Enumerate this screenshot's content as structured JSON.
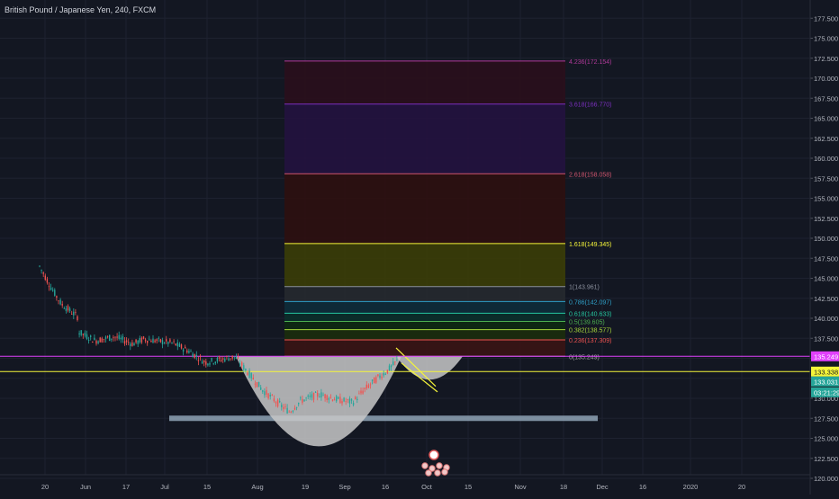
{
  "header": {
    "title": "British Pound / Japanese Yen, 240, FXCM"
  },
  "colors": {
    "background": "#131722",
    "axis_text": "#b2b5be",
    "grid": "#1e2230",
    "up_candle": "#26a69a",
    "down_candle": "#ef5350",
    "magenta": "#e040fb",
    "yellow": "#f5f53a",
    "teal": "#26a69a",
    "cup_fill": "#c8c8c8"
  },
  "chart_data": {
    "type": "candlestick",
    "title": "British Pound / Japanese Yen, 240, FXCM",
    "ylim": [
      118.8,
      178.2
    ],
    "y_ticks": [
      "120.000",
      "122.500",
      "125.000",
      "127.500",
      "130.000",
      "132.500",
      "135.000",
      "137.500",
      "140.000",
      "142.500",
      "145.000",
      "147.500",
      "150.000",
      "152.500",
      "155.000",
      "157.500",
      "160.000",
      "162.500",
      "165.000",
      "167.500",
      "170.000",
      "172.500",
      "175.000",
      "177.500"
    ],
    "x_ticks": [
      "20",
      "Jun",
      "17",
      "Jul",
      "15",
      "Aug",
      "19",
      "Sep",
      "16",
      "Oct",
      "15",
      "Nov",
      "18",
      "Dec",
      "16",
      "2020",
      "20"
    ],
    "price_path": [
      {
        "x": "May 14",
        "close": 146.5
      },
      {
        "x": "May 18",
        "close": 144.0
      },
      {
        "x": "May 22",
        "close": 141.8
      },
      {
        "x": "May 28",
        "close": 140.2
      },
      {
        "x": "Jun 3",
        "close": 138.4
      },
      {
        "x": "Jun 10",
        "close": 137.2
      },
      {
        "x": "Jun 17",
        "close": 137.7
      },
      {
        "x": "Jun 24",
        "close": 136.8
      },
      {
        "x": "Jun 28",
        "close": 137.4
      },
      {
        "x": "Jul 3",
        "close": 136.9
      },
      {
        "x": "Jul 9",
        "close": 135.9
      },
      {
        "x": "Jul 15",
        "close": 134.5
      },
      {
        "x": "Jul 20",
        "close": 134.8
      },
      {
        "x": "Jul 26",
        "close": 135.2
      },
      {
        "x": "Aug 2",
        "close": 131.0
      },
      {
        "x": "Aug 9",
        "close": 129.0
      },
      {
        "x": "Aug 12",
        "close": 128.3
      },
      {
        "x": "Aug 16",
        "close": 129.7
      },
      {
        "x": "Aug 23",
        "close": 130.5
      },
      {
        "x": "Aug 30",
        "close": 129.8
      },
      {
        "x": "Sep 3",
        "close": 129.5
      },
      {
        "x": "Sep 7",
        "close": 131.0
      },
      {
        "x": "Sep 12",
        "close": 132.5
      },
      {
        "x": "Sep 16",
        "close": 133.5
      },
      {
        "x": "Sep 20",
        "close": 134.9
      }
    ],
    "fib_levels": [
      {
        "ratio": "4.236",
        "label": "4.236(172.154)",
        "price": 172.154,
        "line": "#b03a9a",
        "fill": "#2a0e1c"
      },
      {
        "ratio": "3.618",
        "label": "3.618(166.770)",
        "price": 166.77,
        "line": "#7b2fbe",
        "fill": "#24123f"
      },
      {
        "ratio": "2.618",
        "label": "2.618(158.058)",
        "price": 158.058,
        "line": "#d0566f",
        "fill": "#2e0f10"
      },
      {
        "ratio": "1.618",
        "label": "1.618(149.345)",
        "price": 149.345,
        "line": "#f5f53a",
        "fill": "#3b3d07"
      },
      {
        "ratio": "1",
        "label": "1(143.961)",
        "price": 143.961,
        "line": "#8a8f9c",
        "fill": "#26292f"
      },
      {
        "ratio": "0.786",
        "label": "0.786(142.097)",
        "price": 142.097,
        "line": "#2fa0c8",
        "fill": "#0e2c3a"
      },
      {
        "ratio": "0.618",
        "label": "0.618(140.633)",
        "price": 140.633,
        "line": "#26c6a0",
        "fill": "#0b2e2a"
      },
      {
        "ratio": "0.5",
        "label": "0.5(139.605)",
        "price": 139.605,
        "line": "#4caf50",
        "fill": "#0e2a12"
      },
      {
        "ratio": "0.382",
        "label": "0.382(138.577)",
        "price": 138.577,
        "line": "#a5d63a",
        "fill": "#1c2c0c"
      },
      {
        "ratio": "0.236",
        "label": "0.236(137.309)",
        "price": 137.309,
        "line": "#ef5350",
        "fill": "#3a1414"
      },
      {
        "ratio": "0",
        "label": "0(135.249)",
        "price": 135.249,
        "line": "#9e9e9e",
        "fill": null
      }
    ],
    "horizontal_lines": [
      {
        "price": 135.249,
        "color": "#e040fb",
        "label": "135.249"
      },
      {
        "price": 133.338,
        "color": "#f5f53a",
        "label": "133.338"
      }
    ],
    "price_badges": [
      {
        "label": "133.031",
        "color": "#26a69a"
      },
      {
        "label": "03:21:29",
        "color": "#26a69a"
      }
    ],
    "support_zone": {
      "price": 127.5
    },
    "cup": {
      "rim": 135.249,
      "bottom": 124.0
    },
    "handle": {
      "rim": 135.249,
      "bottom": 133.0
    },
    "grid": true
  }
}
